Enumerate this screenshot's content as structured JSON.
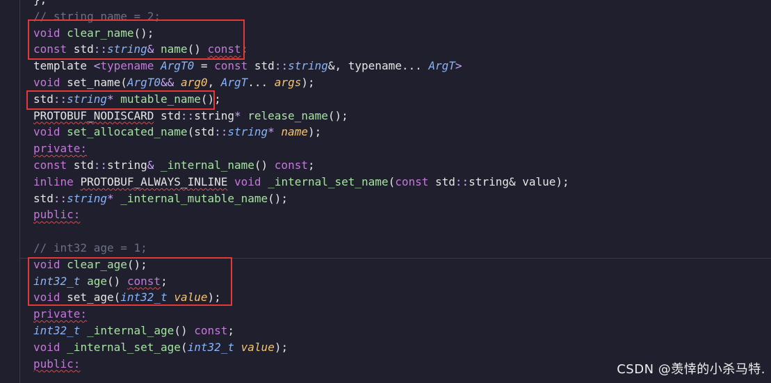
{
  "code_lines": [
    {
      "segments": [
        {
          "t": "};",
          "c": "plain"
        }
      ]
    },
    {
      "segments": [
        {
          "t": "// string name = 2;",
          "c": "comment"
        }
      ]
    },
    {
      "segments": [
        {
          "t": "void",
          "c": "kw"
        },
        {
          "t": " ",
          "c": "plain"
        },
        {
          "t": "clear_name",
          "c": "fn"
        },
        {
          "t": "();",
          "c": "plain"
        }
      ]
    },
    {
      "segments": [
        {
          "t": "const",
          "c": "kw"
        },
        {
          "t": " std",
          "c": "plain"
        },
        {
          "t": "::",
          "c": "op"
        },
        {
          "t": "string",
          "c": "type"
        },
        {
          "t": "& ",
          "c": "op"
        },
        {
          "t": "name",
          "c": "fn"
        },
        {
          "t": "() ",
          "c": "plain"
        },
        {
          "t": "const",
          "c": "kw",
          "sq": true
        },
        {
          "t": ";",
          "c": "plain"
        }
      ]
    },
    {
      "segments": [
        {
          "t": "template",
          "c": "plain"
        },
        {
          "t": " <",
          "c": "op"
        },
        {
          "t": "typename",
          "c": "kw"
        },
        {
          "t": " ",
          "c": "plain"
        },
        {
          "t": "ArgT0",
          "c": "type"
        },
        {
          "t": " = ",
          "c": "plain"
        },
        {
          "t": "const",
          "c": "kw"
        },
        {
          "t": " std",
          "c": "plain"
        },
        {
          "t": "::",
          "c": "op"
        },
        {
          "t": "string",
          "c": "type"
        },
        {
          "t": "&, typename... ",
          "c": "plain"
        },
        {
          "t": "ArgT",
          "c": "type"
        },
        {
          "t": ">",
          "c": "op"
        }
      ]
    },
    {
      "segments": [
        {
          "t": "void",
          "c": "kw"
        },
        {
          "t": " set_name(",
          "c": "plain"
        },
        {
          "t": "ArgT0",
          "c": "type"
        },
        {
          "t": "&& ",
          "c": "op"
        },
        {
          "t": "arg0",
          "c": "param"
        },
        {
          "t": ", ",
          "c": "plain"
        },
        {
          "t": "ArgT",
          "c": "type"
        },
        {
          "t": "... ",
          "c": "plain"
        },
        {
          "t": "args",
          "c": "param"
        },
        {
          "t": ");",
          "c": "plain"
        }
      ]
    },
    {
      "segments": [
        {
          "t": "std",
          "c": "plain"
        },
        {
          "t": "::",
          "c": "op"
        },
        {
          "t": "string",
          "c": "type"
        },
        {
          "t": "* ",
          "c": "op"
        },
        {
          "t": "mutable_name",
          "c": "fn"
        },
        {
          "t": "();",
          "c": "plain"
        }
      ]
    },
    {
      "segments": [
        {
          "t": "PROTOBUF_NODISCARD",
          "c": "plain",
          "sq": true
        },
        {
          "t": " std",
          "c": "plain"
        },
        {
          "t": "::",
          "c": "op"
        },
        {
          "t": "string",
          "c": "plain"
        },
        {
          "t": "* ",
          "c": "op"
        },
        {
          "t": "release_name",
          "c": "fn"
        },
        {
          "t": "();",
          "c": "plain"
        }
      ]
    },
    {
      "segments": [
        {
          "t": "void",
          "c": "kw"
        },
        {
          "t": " ",
          "c": "plain"
        },
        {
          "t": "set_allocated_name",
          "c": "fn"
        },
        {
          "t": "(std",
          "c": "plain"
        },
        {
          "t": "::",
          "c": "op"
        },
        {
          "t": "string",
          "c": "type"
        },
        {
          "t": "* ",
          "c": "op"
        },
        {
          "t": "name",
          "c": "param"
        },
        {
          "t": ");",
          "c": "plain"
        }
      ]
    },
    {
      "segments": [
        {
          "t": "private:",
          "c": "kw",
          "sq": true
        }
      ]
    },
    {
      "segments": [
        {
          "t": "const",
          "c": "kw"
        },
        {
          "t": " std",
          "c": "plain"
        },
        {
          "t": "::",
          "c": "op"
        },
        {
          "t": "string",
          "c": "plain"
        },
        {
          "t": "& ",
          "c": "op"
        },
        {
          "t": "_internal_name",
          "c": "fn"
        },
        {
          "t": "() ",
          "c": "plain"
        },
        {
          "t": "const",
          "c": "kw"
        },
        {
          "t": ";",
          "c": "plain"
        }
      ]
    },
    {
      "segments": [
        {
          "t": "inline",
          "c": "kw"
        },
        {
          "t": " ",
          "c": "plain"
        },
        {
          "t": "PROTOBUF_ALWAYS_INLINE",
          "c": "plain",
          "sq": true
        },
        {
          "t": " ",
          "c": "plain"
        },
        {
          "t": "void",
          "c": "kw"
        },
        {
          "t": " ",
          "c": "plain"
        },
        {
          "t": "_internal_set_name",
          "c": "fn"
        },
        {
          "t": "(",
          "c": "plain"
        },
        {
          "t": "const",
          "c": "kw"
        },
        {
          "t": " std",
          "c": "plain"
        },
        {
          "t": "::",
          "c": "op"
        },
        {
          "t": "string",
          "c": "plain"
        },
        {
          "t": "& value);",
          "c": "plain"
        }
      ]
    },
    {
      "segments": [
        {
          "t": "std",
          "c": "plain"
        },
        {
          "t": "::",
          "c": "op"
        },
        {
          "t": "string",
          "c": "type"
        },
        {
          "t": "* ",
          "c": "op"
        },
        {
          "t": "_internal_mutable_name",
          "c": "fn"
        },
        {
          "t": "();",
          "c": "plain"
        }
      ]
    },
    {
      "segments": [
        {
          "t": "public:",
          "c": "kw",
          "sq": true
        }
      ]
    },
    {
      "segments": [
        {
          "t": "",
          "c": "plain"
        }
      ]
    },
    {
      "segments": [
        {
          "t": "// int32 age = 1;",
          "c": "comment"
        }
      ]
    },
    {
      "segments": [
        {
          "t": "void",
          "c": "kw"
        },
        {
          "t": " ",
          "c": "plain"
        },
        {
          "t": "clear_age",
          "c": "fn"
        },
        {
          "t": "();",
          "c": "plain"
        }
      ]
    },
    {
      "segments": [
        {
          "t": "int32_t",
          "c": "type"
        },
        {
          "t": " ",
          "c": "plain"
        },
        {
          "t": "age",
          "c": "fn"
        },
        {
          "t": "() ",
          "c": "plain"
        },
        {
          "t": "const",
          "c": "kw",
          "sq": true
        },
        {
          "t": ";",
          "c": "plain"
        }
      ]
    },
    {
      "segments": [
        {
          "t": "void",
          "c": "kw"
        },
        {
          "t": " set_age(",
          "c": "plain"
        },
        {
          "t": "int32_t",
          "c": "type"
        },
        {
          "t": " ",
          "c": "plain"
        },
        {
          "t": "value",
          "c": "param"
        },
        {
          "t": ");",
          "c": "plain"
        }
      ]
    },
    {
      "segments": [
        {
          "t": "private:",
          "c": "kw",
          "sq": true
        }
      ]
    },
    {
      "segments": [
        {
          "t": "int32_t",
          "c": "type"
        },
        {
          "t": " ",
          "c": "plain"
        },
        {
          "t": "_internal_age",
          "c": "fn"
        },
        {
          "t": "() ",
          "c": "plain"
        },
        {
          "t": "const",
          "c": "kw"
        },
        {
          "t": ";",
          "c": "plain"
        }
      ]
    },
    {
      "segments": [
        {
          "t": "void",
          "c": "kw"
        },
        {
          "t": " ",
          "c": "plain"
        },
        {
          "t": "_internal_set_age",
          "c": "fn"
        },
        {
          "t": "(",
          "c": "plain"
        },
        {
          "t": "int32_t",
          "c": "type"
        },
        {
          "t": " ",
          "c": "plain"
        },
        {
          "t": "value",
          "c": "param"
        },
        {
          "t": ");",
          "c": "plain"
        }
      ]
    },
    {
      "segments": [
        {
          "t": "public:",
          "c": "kw",
          "sq": true
        }
      ]
    }
  ],
  "watermark": "CSDN @羡悻的小杀马特.",
  "colors": {
    "background": "#1f1f2d",
    "highlight_box": "#e53935",
    "keyword": "#c678dd",
    "function": "#a6e3a1",
    "type": "#89b4fa",
    "parameter": "#f9c46b",
    "comment": "#6c7086"
  }
}
